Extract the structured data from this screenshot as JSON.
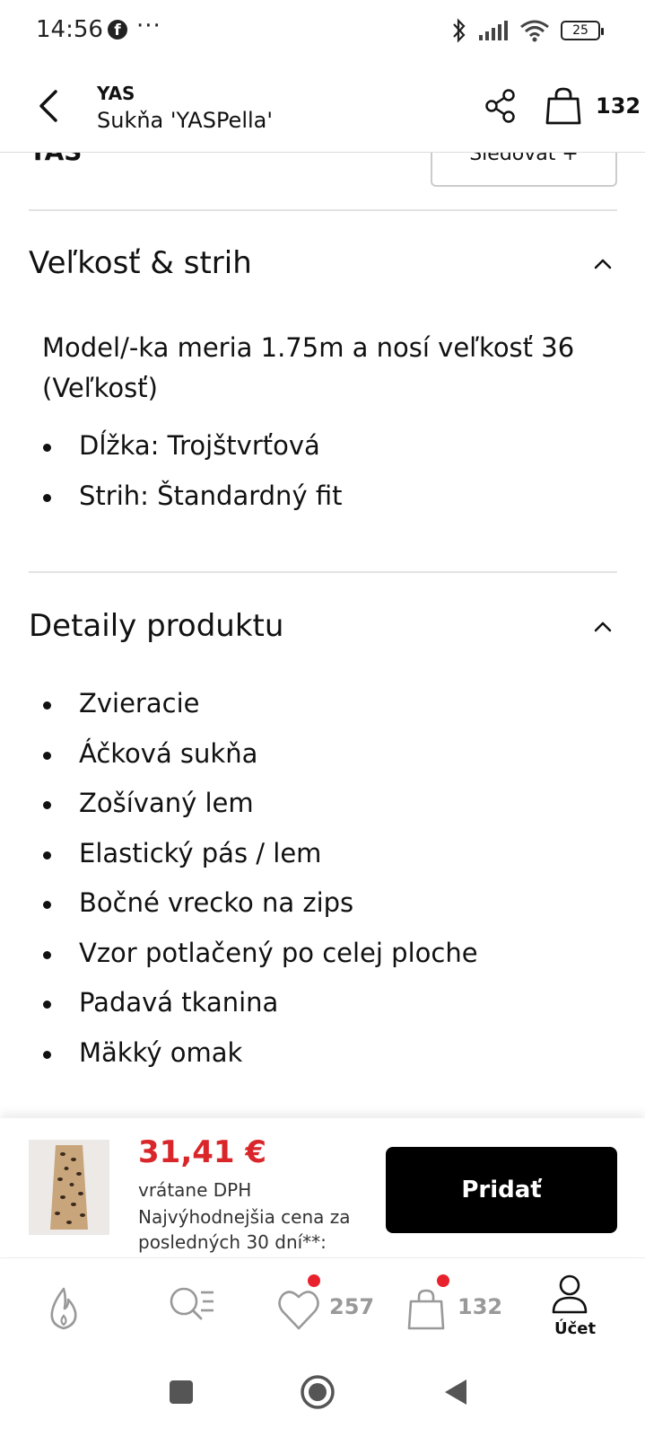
{
  "status_bar": {
    "time": "14:56",
    "app_icon": "facebook-icon",
    "more": "···",
    "battery": "25"
  },
  "header": {
    "brand": "YAS",
    "product_name": "Sukňa 'YASPella'",
    "bag_count": "132"
  },
  "top_partial": {
    "brand": "YAS",
    "follow_label": "Sledovať +"
  },
  "size_section": {
    "title": "Veľkosť & strih",
    "model_info": "Model/-ka meria 1.75m a nosí veľkosť 36 (Veľkosť)",
    "items": [
      "Dĺžka: Trojštvrťová",
      "Strih: Štandardný fit"
    ]
  },
  "details_section": {
    "title": "Detaily produktu",
    "items": [
      "Zvieracie",
      "Áčková sukňa",
      "Zošívaný lem",
      "Elastický pás / lem",
      "Bočné vrecko na zips",
      "Vzor potlačený po celej ploche",
      "Padavá tkanina",
      "Mäkký omak"
    ]
  },
  "purchase_bar": {
    "price": "31,41 €",
    "vat_note": "vrátane DPH",
    "best_price_note": "Najvýhodnejšia cena za posledných 30 dní**:",
    "add_label": "Pridať"
  },
  "bottom_nav": {
    "wishlist_count": "257",
    "bag_count": "132",
    "account_label": "Účet"
  },
  "colors": {
    "price": "#d9262a",
    "badge": "#e8212d",
    "primary_button": "#000000"
  }
}
